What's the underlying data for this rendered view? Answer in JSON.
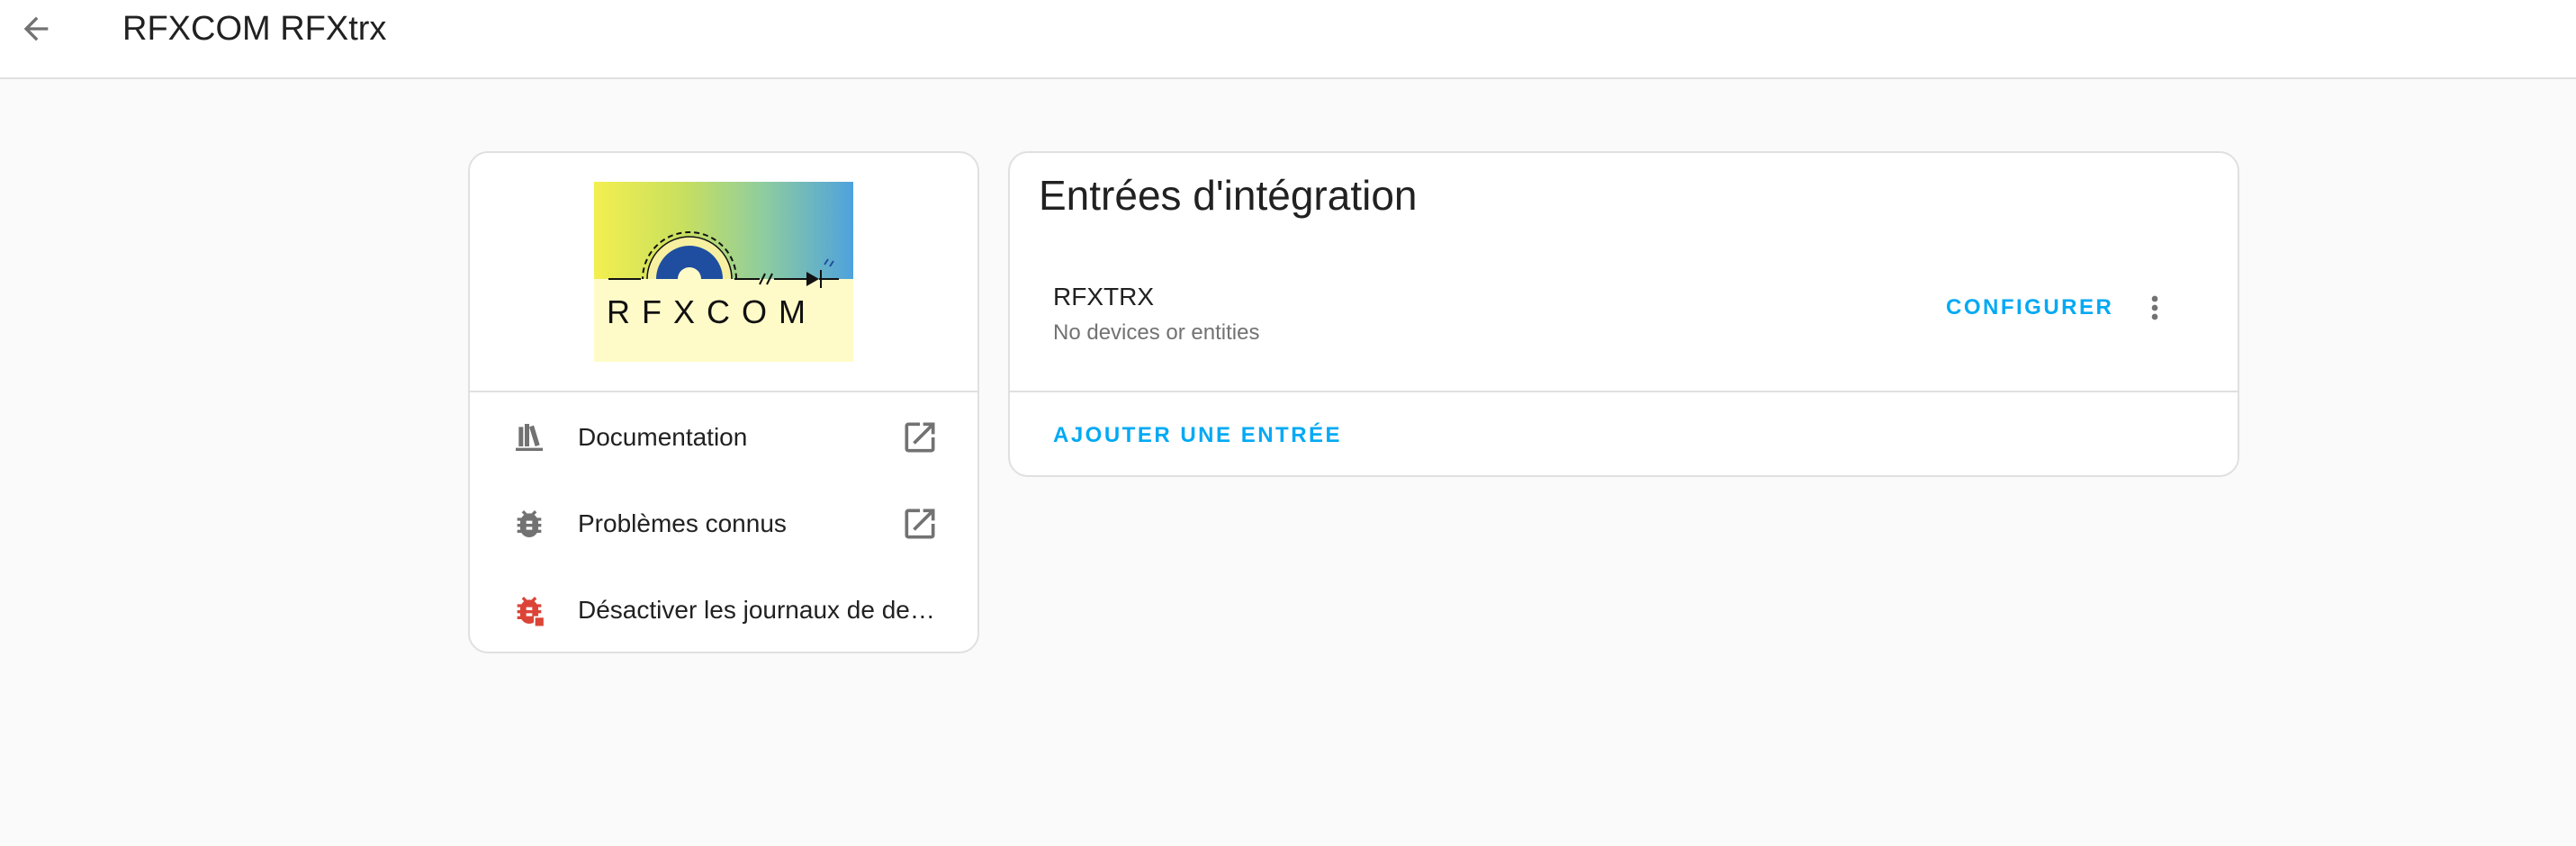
{
  "header": {
    "title": "RFXCOM RFXtrx",
    "back_icon": "arrow-left-icon"
  },
  "info_card": {
    "logo_text": "RFXCOM",
    "links": [
      {
        "label": "Documentation",
        "icon": "bookshelf-icon",
        "trailing_icon": "open-in-new-icon"
      },
      {
        "label": "Problèmes connus",
        "icon": "bug-icon",
        "trailing_icon": "open-in-new-icon"
      },
      {
        "label": "Désactiver les journaux de debogage",
        "icon": "bug-stop-icon"
      }
    ]
  },
  "entries_card": {
    "title": "Entrées d'intégration",
    "entry": {
      "name": "RFXTRX",
      "subtitle": "No devices or entities",
      "configure_label": "CONFIGURER",
      "menu_icon": "dots-vertical-icon"
    },
    "add_label": "AJOUTER UNE ENTRÉE"
  },
  "colors": {
    "primary": "#03a9f4",
    "icon_gray": "#727272",
    "danger": "#db4437",
    "background": "#fafafa"
  }
}
